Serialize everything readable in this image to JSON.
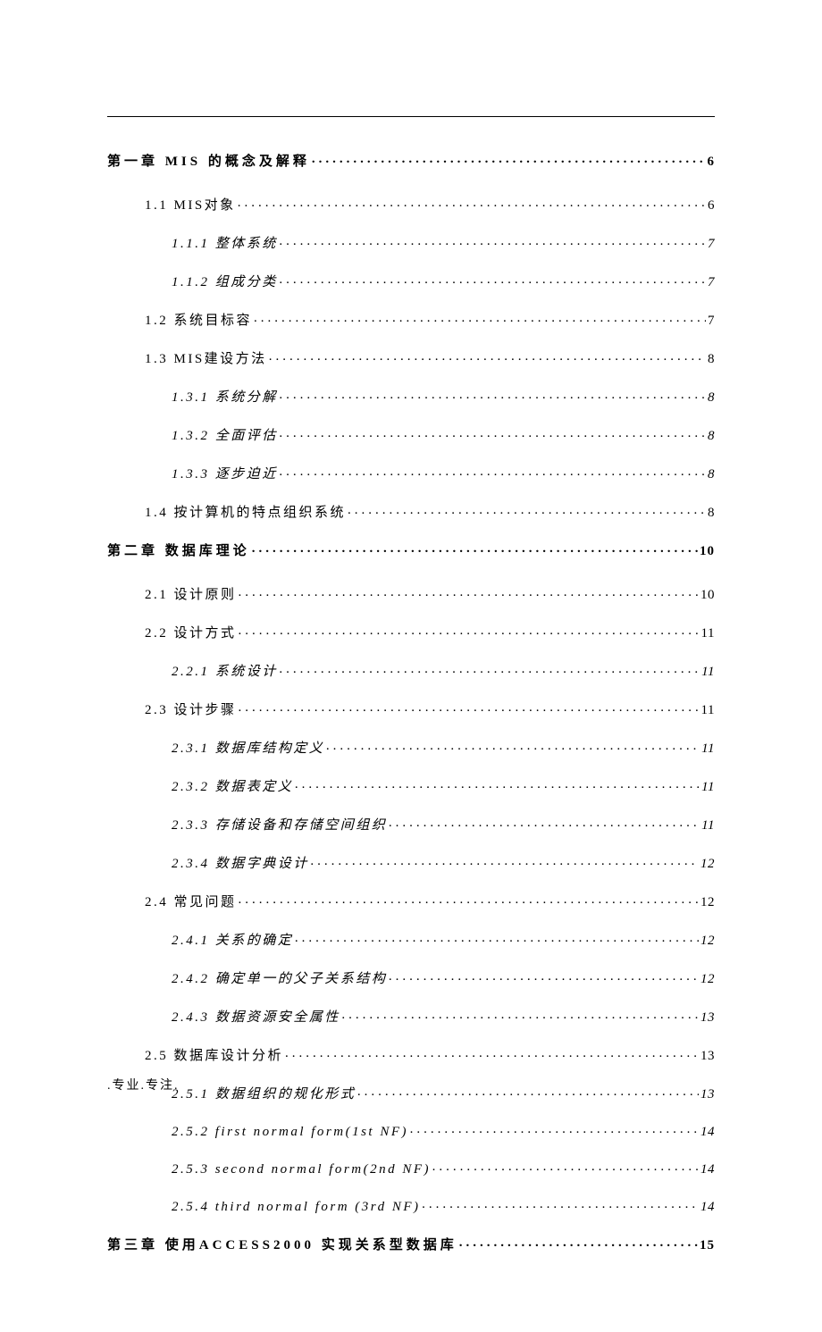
{
  "footer": ".专业.专注.",
  "toc": [
    {
      "level": 1,
      "title": "第一章 MIS 的概念及解释",
      "page": "6"
    },
    {
      "level": 2,
      "title": "1.1 MIS对象",
      "page": "6"
    },
    {
      "level": 3,
      "title": "1.1.1 整体系统",
      "page": "7"
    },
    {
      "level": 3,
      "title": "1.1.2 组成分类",
      "page": "7"
    },
    {
      "level": 2,
      "title": "1.2 系统目标容",
      "page": "7"
    },
    {
      "level": 2,
      "title": "1.3 MIS建设方法",
      "page": "8"
    },
    {
      "level": 3,
      "title": "1.3.1 系统分解",
      "page": "8"
    },
    {
      "level": 3,
      "title": "1.3.2 全面评估",
      "page": "8"
    },
    {
      "level": 3,
      "title": "1.3.3 逐步迫近",
      "page": "8"
    },
    {
      "level": 2,
      "title": "1.4 按计算机的特点组织系统",
      "page": "8"
    },
    {
      "level": 1,
      "title": "第二章 数据库理论",
      "page": "10"
    },
    {
      "level": 2,
      "title": "2.1 设计原则",
      "page": "10"
    },
    {
      "level": 2,
      "title": "2.2  设计方式",
      "page": "11"
    },
    {
      "level": 3,
      "title": "2.2.1 系统设计",
      "page": "11"
    },
    {
      "level": 2,
      "title": "2.3 设计步骤",
      "page": "11"
    },
    {
      "level": 3,
      "title": "2.3.1 数据库结构定义",
      "page": "11"
    },
    {
      "level": 3,
      "title": "2.3.2 数据表定义",
      "page": "11"
    },
    {
      "level": 3,
      "title": "2.3.3 存储设备和存储空间组织",
      "page": "11"
    },
    {
      "level": 3,
      "title": "2.3.4 数据字典设计",
      "page": "12"
    },
    {
      "level": 2,
      "title": "2.4 常见问题",
      "page": "12"
    },
    {
      "level": 3,
      "title": "2.4.1 关系的确定",
      "page": "12"
    },
    {
      "level": 3,
      "title": "2.4.2 确定单一的父子关系结构",
      "page": "12"
    },
    {
      "level": 3,
      "title": "2.4.3 数据资源安全属性",
      "page": "13"
    },
    {
      "level": 2,
      "title": "2.5  数据库设计分析",
      "page": "13"
    },
    {
      "level": 3,
      "title": "2.5.1 数据组织的规化形式",
      "page": "13"
    },
    {
      "level": 3,
      "title": "2.5.2  first normal form(1st NF)",
      "page": "14"
    },
    {
      "level": 3,
      "title": "2.5.3  second normal form(2nd NF)",
      "page": "14"
    },
    {
      "level": 3,
      "title": "2.5.4  third normal form (3rd NF)",
      "page": "14"
    },
    {
      "level": 1,
      "title": "第三章 使用ACCESS2000 实现关系型数据库",
      "page": "15"
    }
  ]
}
